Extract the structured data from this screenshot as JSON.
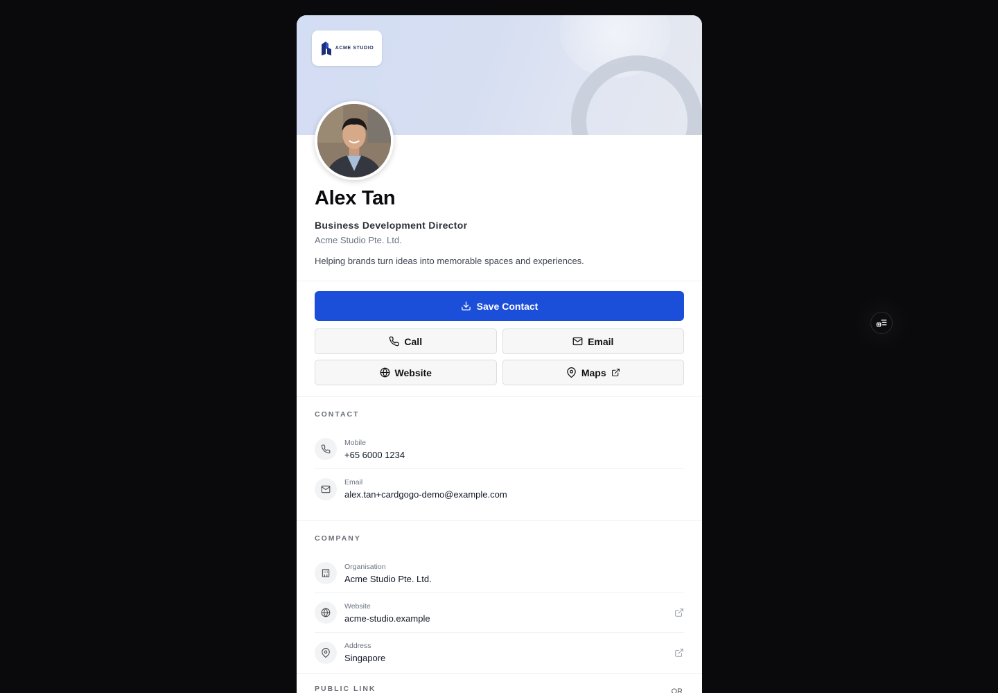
{
  "brand": {
    "logo_text": "ACME STUDIO",
    "accent": "#1c4fd9"
  },
  "profile": {
    "name": "Alex Tan",
    "title": "Business Development Director",
    "company": "Acme Studio Pte. Ltd.",
    "bio": "Helping brands turn ideas into memorable spaces and experiences."
  },
  "actions": {
    "save_label": "Save Contact",
    "call_label": "Call",
    "email_label": "Email",
    "website_label": "Website",
    "maps_label": "Maps"
  },
  "contact": {
    "section_label": "CONTACT",
    "items": [
      {
        "label": "Mobile",
        "value": "+65 6000 1234",
        "icon": "phone-icon"
      },
      {
        "label": "Email",
        "value": "alex.tan+cardgogo-demo@example.com",
        "icon": "mail-icon"
      }
    ]
  },
  "company_section": {
    "section_label": "COMPANY",
    "items": [
      {
        "label": "Organisation",
        "value": "Acme Studio Pte. Ltd.",
        "icon": "building-icon"
      },
      {
        "label": "Website",
        "value": "acme-studio.example",
        "icon": "globe-icon"
      },
      {
        "label": "Address",
        "value": "Singapore",
        "icon": "map-pin-icon"
      }
    ]
  },
  "public_link": {
    "section_label": "PUBLIC LINK",
    "qr_label": "QR"
  }
}
